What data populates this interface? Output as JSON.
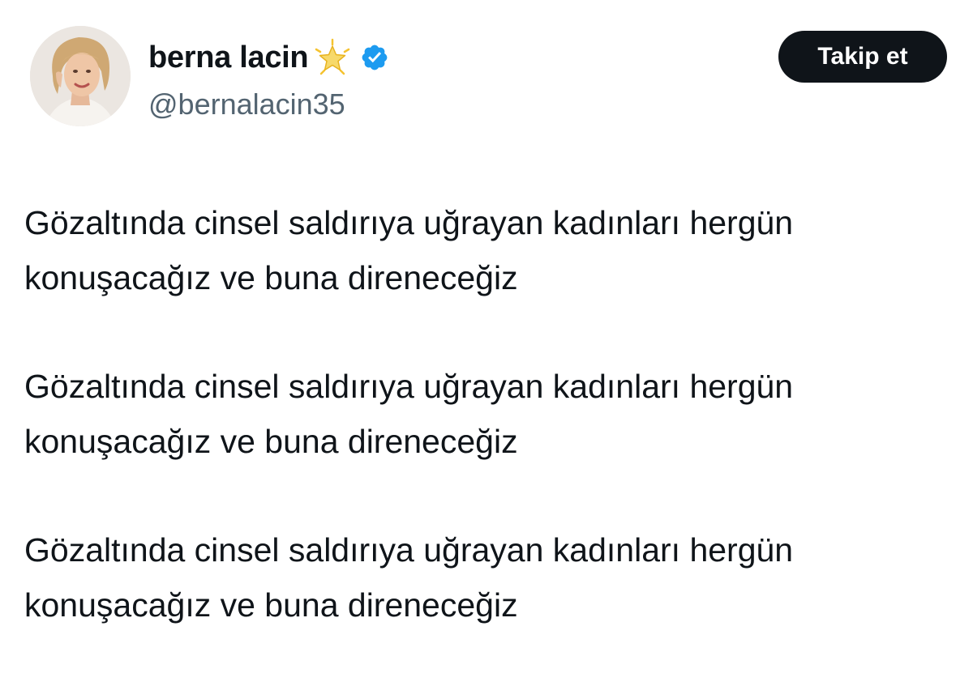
{
  "tweet": {
    "author": {
      "display_name": "berna lacin",
      "name_emoji": "star-icon",
      "verified_badge": "verified-icon",
      "handle": "@bernalacin35",
      "avatar": "avatar"
    },
    "follow_button_label": "Takip et",
    "paragraphs": [
      {
        "line1": "Gözaltında cinsel saldırıya uğrayan kadınları hergün",
        "line2": "konuşacağız ve buna direneceğiz"
      },
      {
        "line1": "Gözaltında cinsel saldırıya uğrayan kadınları hergün",
        "line2": "konuşacağız ve buna direneceğiz"
      },
      {
        "line1": "Gözaltında cinsel saldırıya uğrayan kadınları hergün",
        "line2": "konuşacağız ve buna direneceğiz"
      }
    ]
  },
  "colors": {
    "text_primary": "#0f1419",
    "text_secondary": "#536471",
    "verified_blue": "#1d9bf0",
    "button_background": "#0f1419",
    "button_text": "#ffffff",
    "star_gold": "#f5c330"
  }
}
